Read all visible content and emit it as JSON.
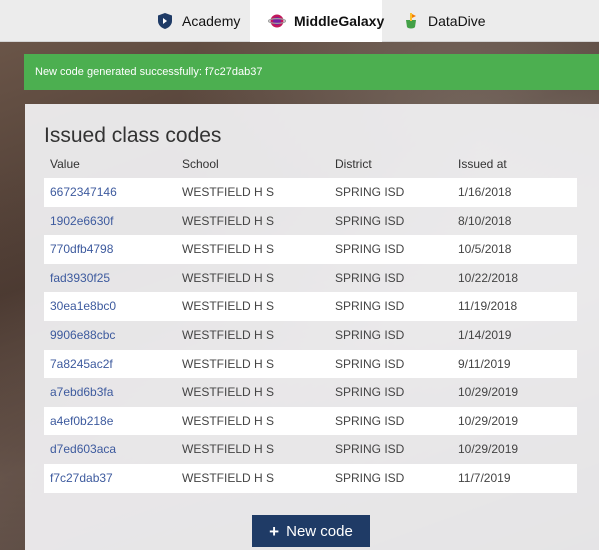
{
  "tabs": [
    {
      "label": "Academy",
      "icon": "shield-icon",
      "active": false
    },
    {
      "label": "MiddleGalaxy",
      "icon": "galaxy-icon",
      "active": true
    },
    {
      "label": "DataDive",
      "icon": "datadive-icon",
      "active": false
    }
  ],
  "banner": {
    "message": "New code generated successfully: f7c27dab37",
    "color": "#4caf50"
  },
  "panel": {
    "title": "Issued class codes",
    "columns": [
      "Value",
      "School",
      "District",
      "Issued at"
    ],
    "rows": [
      {
        "value": "6672347146",
        "school": "WESTFIELD H S",
        "district": "SPRING ISD",
        "issued": "1/16/2018"
      },
      {
        "value": "1902e6630f",
        "school": "WESTFIELD H S",
        "district": "SPRING ISD",
        "issued": "8/10/2018"
      },
      {
        "value": "770dfb4798",
        "school": "WESTFIELD H S",
        "district": "SPRING ISD",
        "issued": "10/5/2018"
      },
      {
        "value": "fad3930f25",
        "school": "WESTFIELD H S",
        "district": "SPRING ISD",
        "issued": "10/22/2018"
      },
      {
        "value": "30ea1e8bc0",
        "school": "WESTFIELD H S",
        "district": "SPRING ISD",
        "issued": "11/19/2018"
      },
      {
        "value": "9906e88cbc",
        "school": "WESTFIELD H S",
        "district": "SPRING ISD",
        "issued": "1/14/2019"
      },
      {
        "value": "7a8245ac2f",
        "school": "WESTFIELD H S",
        "district": "SPRING ISD",
        "issued": "9/11/2019"
      },
      {
        "value": "a7ebd6b3fa",
        "school": "WESTFIELD H S",
        "district": "SPRING ISD",
        "issued": "10/29/2019"
      },
      {
        "value": "a4ef0b218e",
        "school": "WESTFIELD H S",
        "district": "SPRING ISD",
        "issued": "10/29/2019"
      },
      {
        "value": "d7ed603aca",
        "school": "WESTFIELD H S",
        "district": "SPRING ISD",
        "issued": "10/29/2019"
      },
      {
        "value": "f7c27dab37",
        "school": "WESTFIELD H S",
        "district": "SPRING ISD",
        "issued": "11/7/2019"
      }
    ],
    "new_code_label": "New code",
    "new_code_icon": "plus-icon"
  },
  "colors": {
    "link": "#3d5a9e",
    "button": "#1f3b66",
    "success": "#4caf50"
  }
}
